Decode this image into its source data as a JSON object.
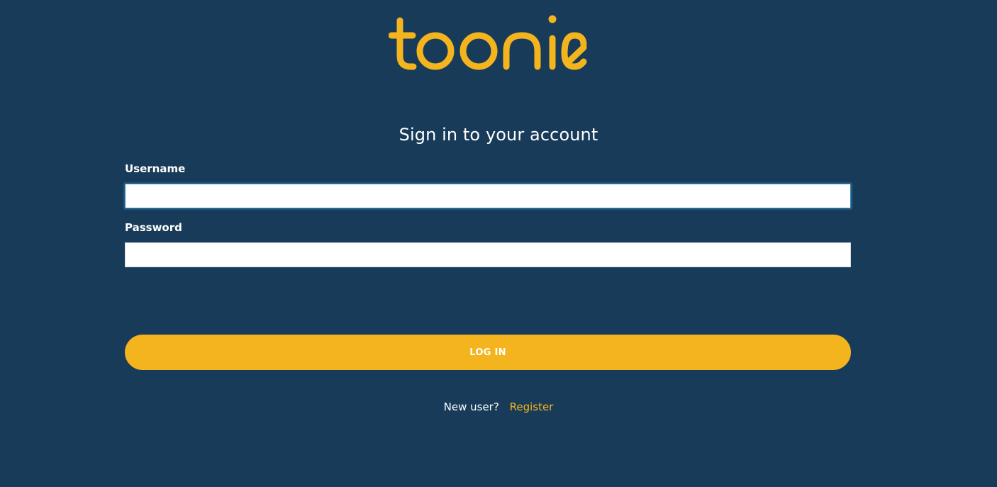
{
  "brand": {
    "logo_text": "toonie",
    "accent_color": "#f4b41e",
    "background_color": "#173b59"
  },
  "form": {
    "heading": "Sign in to your account",
    "username": {
      "label": "Username",
      "value": "",
      "placeholder": ""
    },
    "password": {
      "label": "Password",
      "value": "",
      "placeholder": ""
    },
    "login_label": "LOG IN"
  },
  "footer": {
    "new_user_prompt": "New user?",
    "register_label": "Register"
  }
}
